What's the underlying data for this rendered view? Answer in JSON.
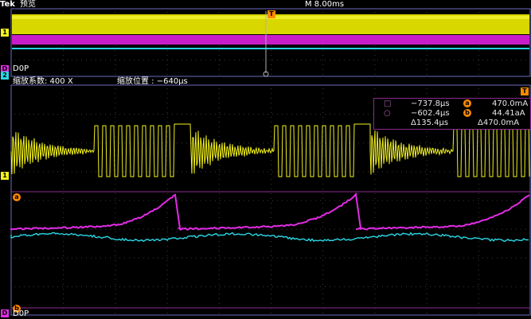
{
  "header": {
    "brand": "Tek",
    "mode": "预览",
    "timebase": "M 8.00ms"
  },
  "overview": {
    "channel1_marker": "1",
    "channel2_marker": "2",
    "dop_marker": "D",
    "dop_label": "D0P",
    "trigger_marker": "T"
  },
  "zoom": {
    "factor_label": "缩放系数: 400 X",
    "position_label": "缩放位置 :  −640μs",
    "trigger_marker": "T"
  },
  "markers": {
    "ch1": "1",
    "cursor_a": "a",
    "cursor_b": "b",
    "dop": "D",
    "dop_label": "D0P"
  },
  "cursor_readout": {
    "row1_time": "−737.8μs",
    "row1_value": "470.0mA",
    "row2_time": "−602.4μs",
    "row2_value": "44.41aA",
    "delta_time": "Δ135.4μs",
    "delta_value": "Δ470.0mA"
  },
  "colors": {
    "ch1": "#f2f21e",
    "ch2": "#2ad8e6",
    "math": "#e22ce6",
    "cursor": "#a02ca0",
    "ref": "#ff8a00",
    "frame": "#7f7fff"
  }
}
